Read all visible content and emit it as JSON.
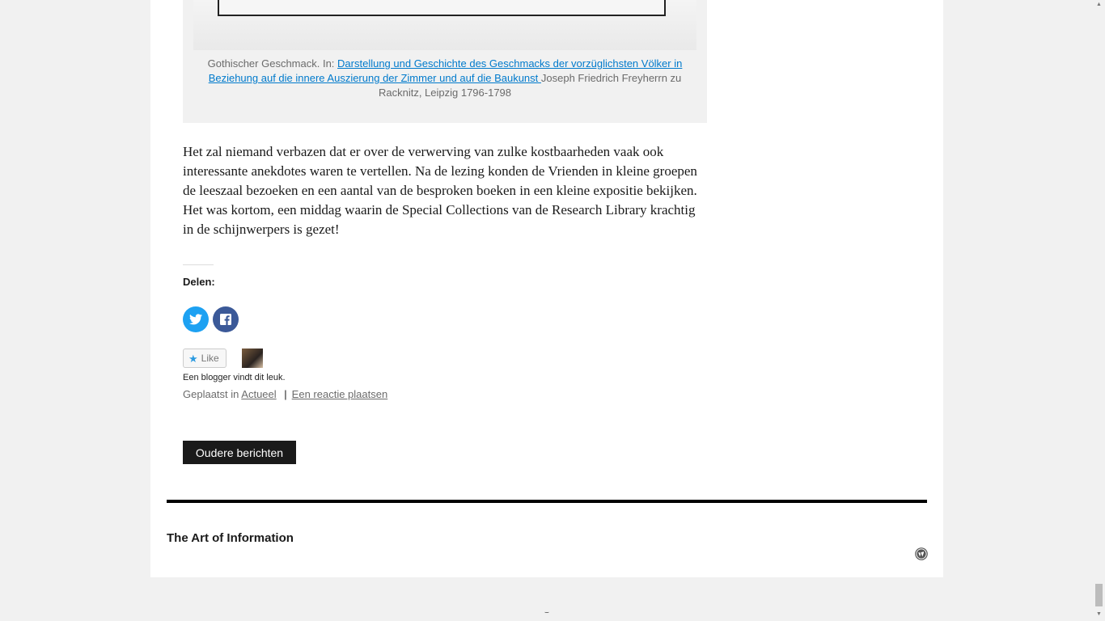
{
  "figure": {
    "caption_prefix": "Gothischer Geschmack. In: ",
    "caption_link": "Darstellung und Geschichte des Geschmacks der vorzüglichsten Völker in Beziehung auf die innere Auszierung der Zimmer und auf die Baukunst ",
    "caption_suffix": "Joseph Friedrich Freyherrn zu Racknitz, Leipzig 1796-1798"
  },
  "article": {
    "paragraph": "Het zal niemand verbazen dat er over de verwerving van zulke kostbaarheden vaak ook interessante anekdotes waren te vertellen. Na de lezing konden de Vrienden in kleine groepen de leeszaal bezoeken en een aantal van de besproken boeken in een kleine expositie bekijken. Het was kortom, een middag waarin de Special Collections van de Research Library krachtig in de schijnwerpers is gezet!"
  },
  "share": {
    "title": "Delen:",
    "buttons": [
      "twitter-icon",
      "facebook-icon"
    ]
  },
  "like": {
    "label": "Like",
    "liked_text": "Een blogger vindt dit leuk."
  },
  "meta": {
    "posted_in": "Geplaatst in",
    "category": "Actueel",
    "separator": "|",
    "comment": "Een reactie plaatsen"
  },
  "nav": {
    "older": "Oudere berichten"
  },
  "footer": {
    "site_title": "The Art of Information",
    "icon": "wordpress-icon"
  },
  "colors": {
    "link": "#007acc",
    "twitter": "#1da1f2",
    "facebook": "#3b5998",
    "button_dark": "#1a1a1a"
  }
}
